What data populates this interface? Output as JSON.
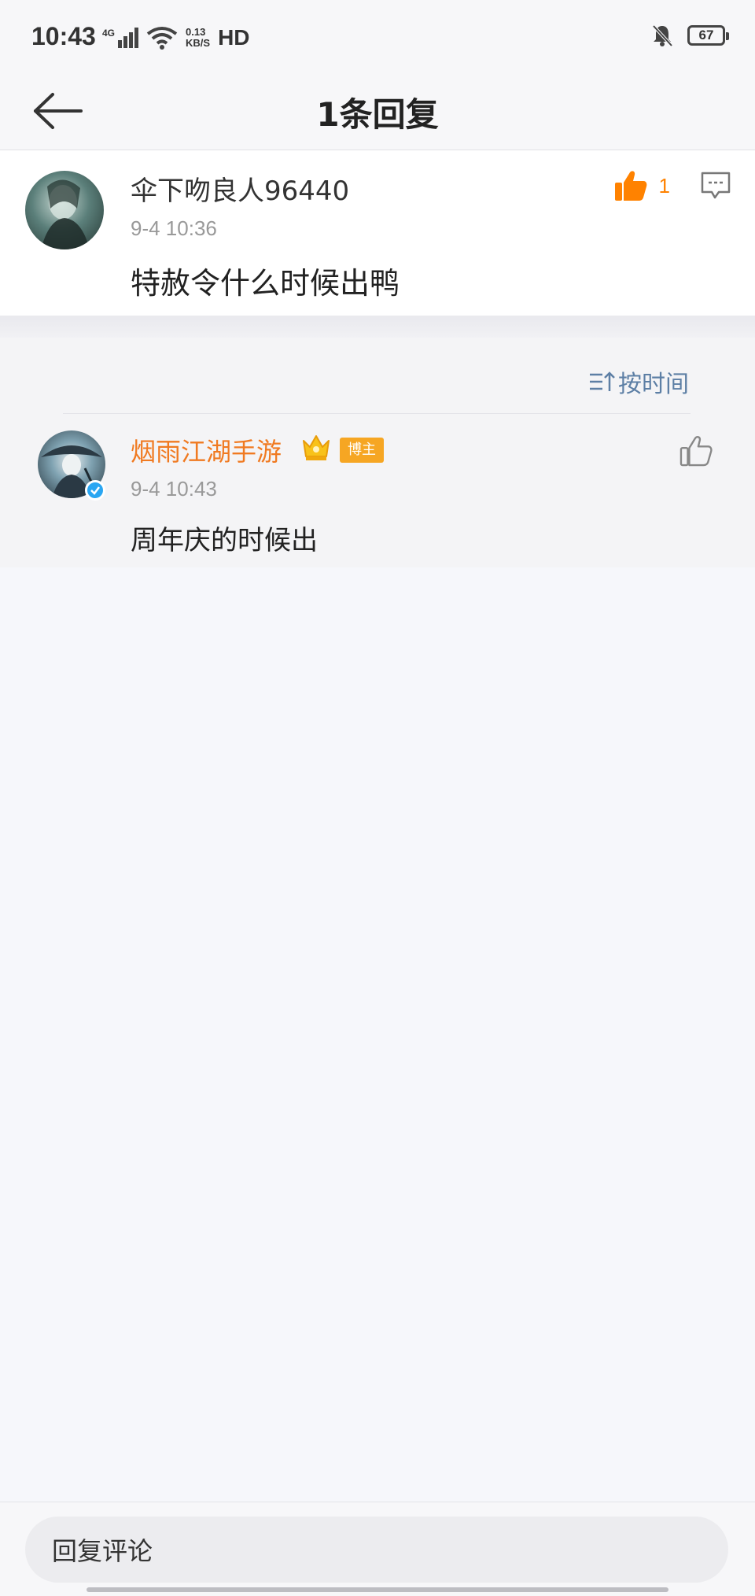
{
  "status_bar": {
    "time": "10:43",
    "network": "4G",
    "speed_value": "0.13",
    "speed_unit": "KB/S",
    "hd": "HD",
    "battery": "67"
  },
  "nav": {
    "title": "1条回复"
  },
  "main_comment": {
    "user_name": "伞下吻良人96440",
    "time": "9-4 10:36",
    "text": "特赦令什么时候出鸭",
    "like_count": "1",
    "like_active": true
  },
  "sort": {
    "label": "按时间"
  },
  "reply": {
    "user_name": "烟雨江湖手游",
    "badge": "博主",
    "time": "9-4 10:43",
    "text": "周年庆的时候出"
  },
  "composer": {
    "placeholder": "回复评论"
  },
  "colors": {
    "accent_orange": "#ff8200",
    "official_name": "#f07a21",
    "link_blue": "#5d7fa5",
    "verified_blue": "#2aa6f2"
  }
}
